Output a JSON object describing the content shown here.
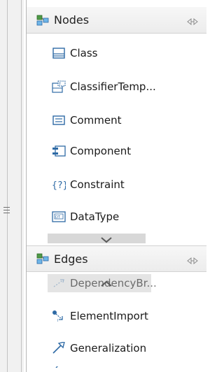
{
  "palette": {
    "nodes_drawer": {
      "title": "Nodes",
      "icon": "palette-drawer-icon",
      "pin_icon": "pin-icon",
      "items": [
        {
          "label": "Class",
          "icon": "class-icon"
        },
        {
          "label": "ClassifierTemp...",
          "icon": "classifier-template-icon"
        },
        {
          "label": "Comment",
          "icon": "comment-icon"
        },
        {
          "label": "Component",
          "icon": "component-icon"
        },
        {
          "label": "Constraint",
          "icon": "constraint-icon"
        },
        {
          "label": "DataType",
          "icon": "datatype-icon"
        }
      ]
    },
    "edges_drawer": {
      "title": "Edges",
      "icon": "palette-drawer-icon",
      "pin_icon": "pin-icon",
      "items": [
        {
          "label": "DependencyBr...",
          "icon": "dependency-icon"
        },
        {
          "label": "ElementImport",
          "icon": "element-import-icon"
        },
        {
          "label": "Generalization",
          "icon": "generalization-icon"
        }
      ]
    }
  },
  "colors": {
    "accent_blue": "#3a6fb5",
    "icon_green": "#4e9a45",
    "header_bg": "#ececec"
  }
}
